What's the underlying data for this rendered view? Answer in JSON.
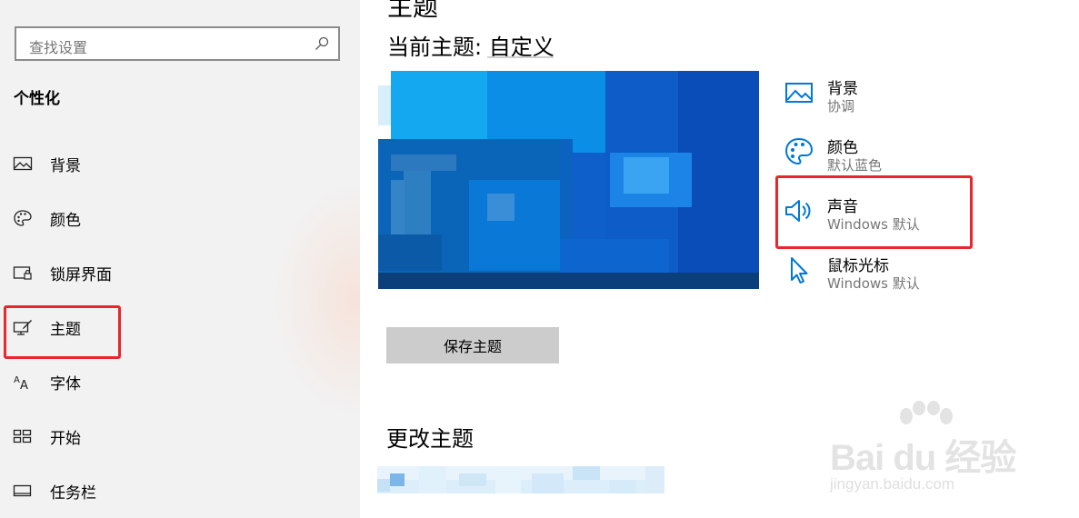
{
  "search": {
    "placeholder": "查找设置"
  },
  "sidebar": {
    "section_title": "个性化",
    "items": [
      {
        "label": "背景",
        "icon": "picture-icon"
      },
      {
        "label": "颜色",
        "icon": "palette-icon"
      },
      {
        "label": "锁屏界面",
        "icon": "lock-screen-icon"
      },
      {
        "label": "主题",
        "icon": "theme-brush-icon"
      },
      {
        "label": "字体",
        "icon": "font-icon"
      },
      {
        "label": "开始",
        "icon": "start-grid-icon"
      },
      {
        "label": "任务栏",
        "icon": "taskbar-icon"
      }
    ]
  },
  "main": {
    "current_theme_label": "当前主题: 自定义",
    "properties": [
      {
        "title": "背景",
        "value": "协调",
        "icon": "picture-icon"
      },
      {
        "title": "颜色",
        "value": "默认蓝色",
        "icon": "palette-icon"
      },
      {
        "title": "声音",
        "value": "Windows 默认",
        "icon": "speaker-icon"
      },
      {
        "title": "鼠标光标",
        "value": "Windows 默认",
        "icon": "cursor-icon"
      }
    ],
    "save_button": "保存主题",
    "change_theme_label": "更改主题"
  },
  "watermark": {
    "text": "Bai du 经验",
    "sub": "jingyan.baidu.com"
  },
  "colors": {
    "accent": "#0078d7",
    "highlight": "#e9262c",
    "sidebar_bg": "#f2f2f2"
  }
}
